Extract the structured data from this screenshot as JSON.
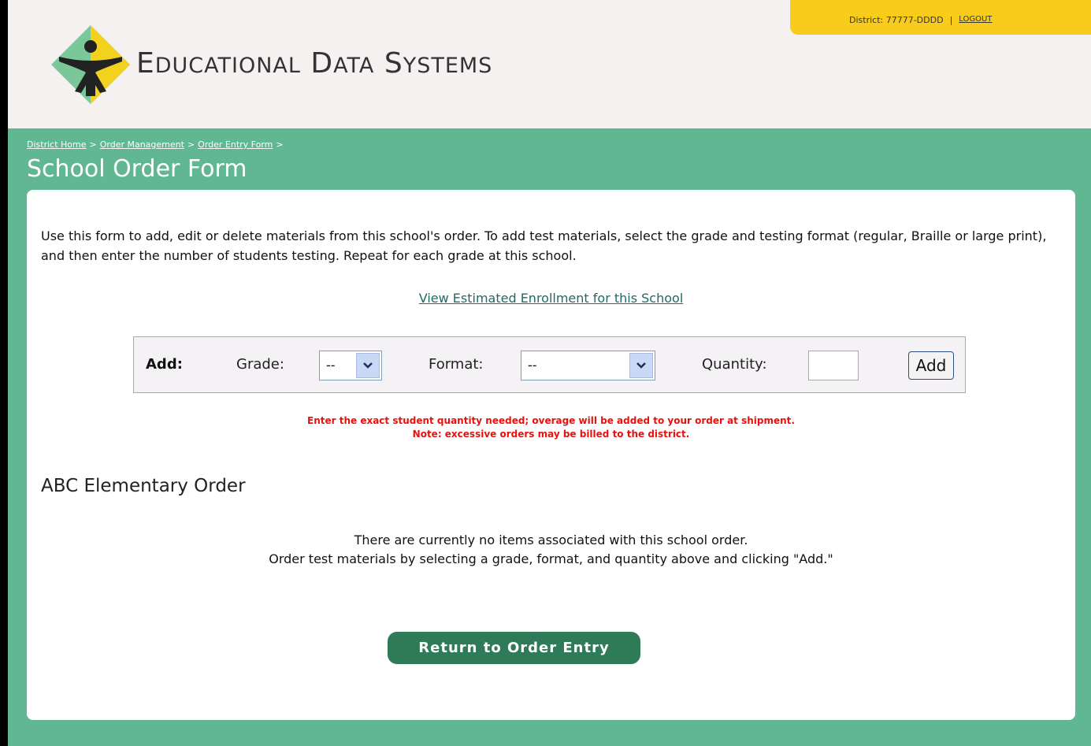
{
  "header": {
    "brand_name": "Educational Data Systems",
    "district_label": "District:",
    "district_id": "77777-DDDD",
    "separator": "|",
    "logout_label": "LOGOUT"
  },
  "breadcrumb": {
    "items": [
      "District Home",
      "Order Management",
      "Order Entry Form"
    ],
    "separator": ">"
  },
  "page_title": "School Order Form",
  "intro_text": "Use this form to add, edit or delete materials from this school's order. To add test materials, select the grade and testing format (regular, Braille or large print), and then enter the number of students testing. Repeat for each grade at this school.",
  "estimated_enrollment_link": "View Estimated Enrollment for this School",
  "add_form": {
    "add_label": "Add:",
    "grade_label": "Grade:",
    "grade_value": "--",
    "format_label": "Format:",
    "format_value": "--",
    "quantity_label": "Quantity:",
    "quantity_value": "",
    "add_button": "Add"
  },
  "notice": {
    "line1": "Enter the exact student quantity needed; overage will be added to your order at shipment.",
    "line2": "Note: excessive orders may be billed to the district."
  },
  "order": {
    "heading": "ABC Elementary Order",
    "empty_line1": "There are currently no items associated with this school order.",
    "empty_line2": "Order test materials by selecting a grade, format, and quantity above and clicking \"Add.\""
  },
  "return_button": "Return to Order Entry",
  "colors": {
    "band": "#62b793",
    "header_bg": "#f6f1f1",
    "userbar": "#f7cc1a",
    "button": "#2f7a57",
    "notice": "#e8110e"
  }
}
